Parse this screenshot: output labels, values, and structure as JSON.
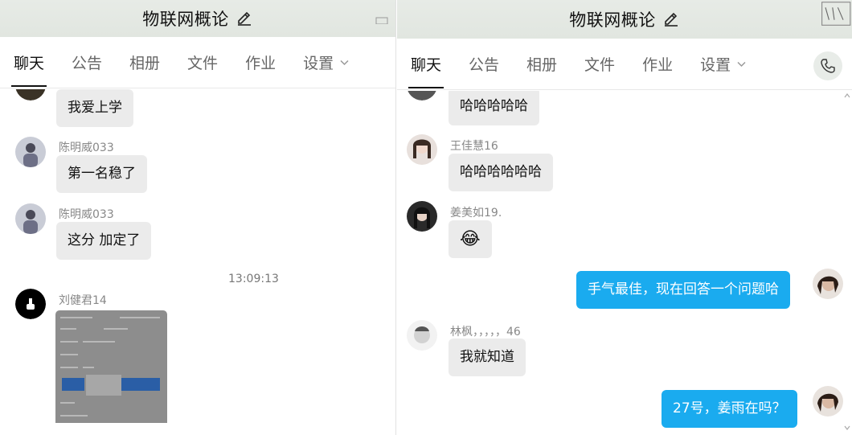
{
  "left": {
    "title": "物联网概论",
    "tabs": [
      "聊天",
      "公告",
      "相册",
      "文件",
      "作业",
      "设置"
    ],
    "messages": [
      {
        "sender": "",
        "text": "我爱上学"
      },
      {
        "sender": "陈明威033",
        "text": "第一名稳了"
      },
      {
        "sender": "陈明威033",
        "text": "这分 加定了"
      }
    ],
    "timestamp": "13:09:13",
    "image_sender": "刘健君14"
  },
  "right": {
    "title": "物联网概论",
    "tabs": [
      "聊天",
      "公告",
      "相册",
      "文件",
      "作业",
      "设置"
    ],
    "messages": [
      {
        "sender": "",
        "text": "哈哈哈哈哈",
        "mine": false
      },
      {
        "sender": "王佳慧16",
        "text": "哈哈哈哈哈哈",
        "mine": false
      },
      {
        "sender": "姜美如19.",
        "text": "😂",
        "mine": false
      },
      {
        "sender": "",
        "text": "手气最佳，现在回答一个问题哈",
        "mine": true
      },
      {
        "sender": "林枫，，，，，46",
        "text": "我就知道",
        "mine": false
      },
      {
        "sender": "",
        "text": "27号，姜雨在吗？",
        "mine": true
      }
    ]
  },
  "colors": {
    "accent_blue": "#1aabef",
    "bubble_gray": "#ebebeb",
    "titlebar": "#e3e8e2"
  },
  "icons": [
    "edit-pencil-icon",
    "chevron-down-icon",
    "phone-icon"
  ]
}
